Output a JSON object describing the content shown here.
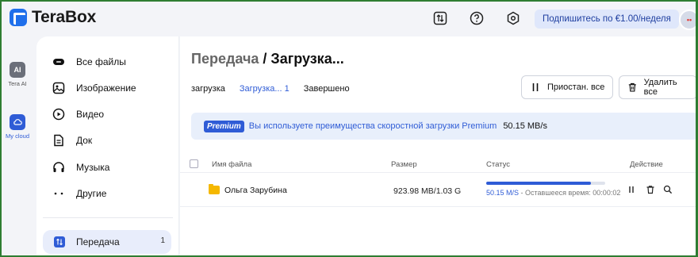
{
  "app": {
    "name": "TeraBox"
  },
  "topbar": {
    "subscribe_label": "Подпишитесь по €1.00/неделя",
    "avatar_text": "••",
    "icons": [
      "transfer-icon",
      "help-icon",
      "settings-icon"
    ]
  },
  "rail": {
    "items": [
      {
        "label": "Tera AI",
        "icon": "ai-icon"
      },
      {
        "label": "My cloud",
        "icon": "cloud-icon"
      }
    ]
  },
  "sidebar": {
    "items": [
      {
        "label": "Все файлы",
        "icon": "all-files-icon"
      },
      {
        "label": "Изображение",
        "icon": "image-icon"
      },
      {
        "label": "Видео",
        "icon": "video-icon"
      },
      {
        "label": "Док",
        "icon": "document-icon"
      },
      {
        "label": "Музыка",
        "icon": "music-icon"
      },
      {
        "label": "Другие",
        "icon": "other-icon"
      }
    ],
    "transfer": {
      "label": "Передача",
      "count": "1"
    }
  },
  "main": {
    "title_part1": "Передача",
    "title_sep": " / ",
    "title_part2": "Загрузка...",
    "tabs": [
      "загрузка",
      "Загрузка... 1",
      "Завершено"
    ],
    "active_tab": 1,
    "pause_all_label": "Приостан. все",
    "delete_all_label": "Удалить все",
    "banner": {
      "tag": "Premium",
      "text": "Вы используете преимущества скоростной загрузки Premium",
      "speed": "50.15 MB/s"
    },
    "columns": {
      "name": "Имя файла",
      "size": "Размер",
      "status": "Статус",
      "action": "Действие"
    },
    "rows": [
      {
        "name": "Ольга Зарубина",
        "size": "923.98 MB/1.03 G",
        "progress": 0.88,
        "speed": "50.15 M/S",
        "remaining": " - Оставшееся время: 00:00:02"
      }
    ]
  },
  "colors": {
    "accent": "#2f5cd6",
    "folder": "#f5b800",
    "banner_bg": "#e8effb"
  }
}
